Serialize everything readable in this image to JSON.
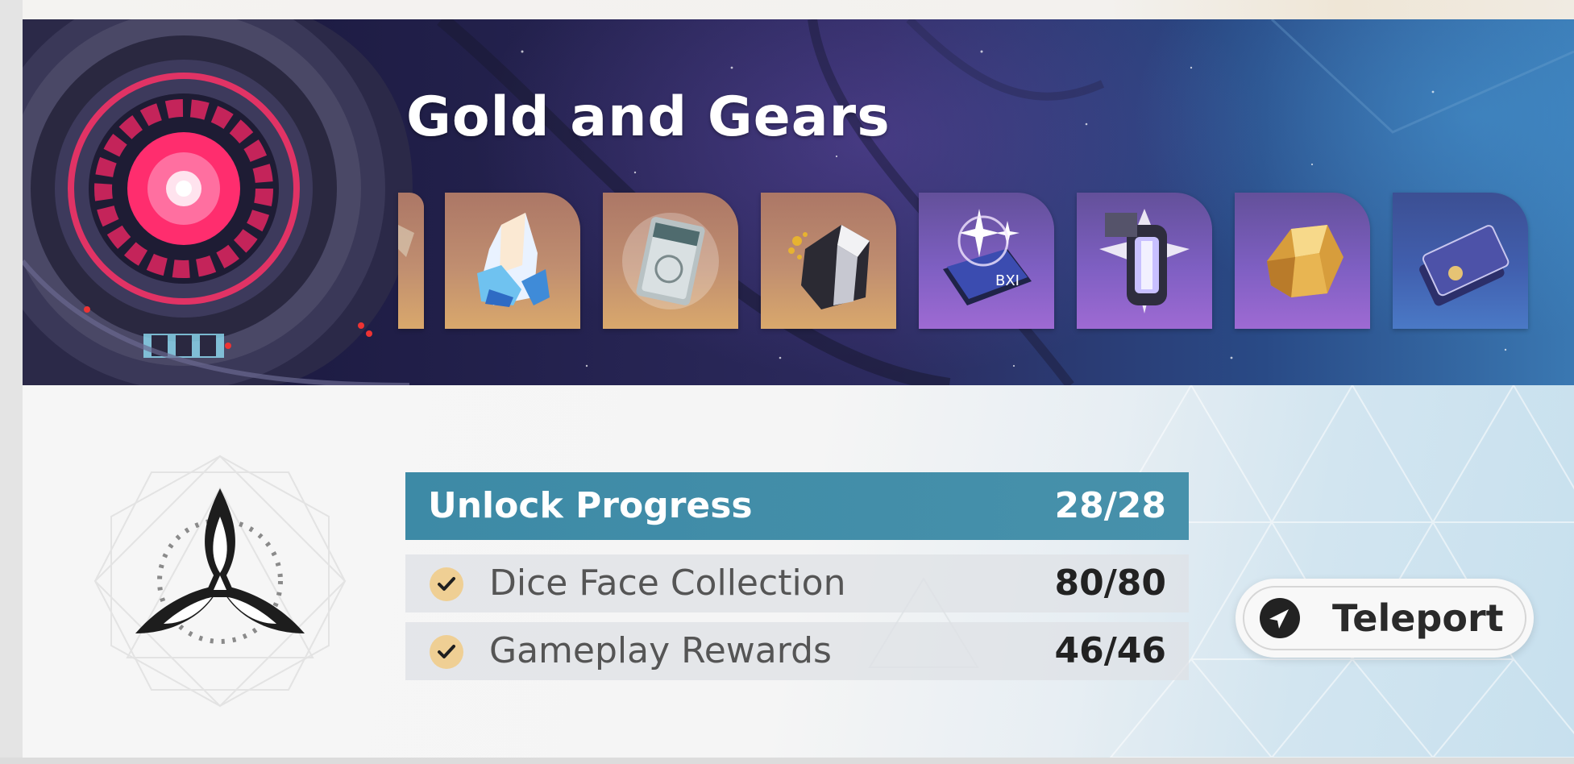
{
  "event": {
    "title": "Gold and Gears"
  },
  "rewards": [
    {
      "name": "partial-item",
      "rarity": "gold"
    },
    {
      "name": "stellar-jade",
      "rarity": "gold"
    },
    {
      "name": "star-rail-pass",
      "rarity": "gold"
    },
    {
      "name": "ore-chunk",
      "rarity": "gold"
    },
    {
      "name": "travel-encounters-book",
      "rarity": "purple"
    },
    {
      "name": "lantern-material",
      "rarity": "purple"
    },
    {
      "name": "gold-ore",
      "rarity": "purple"
    },
    {
      "name": "credential-cards",
      "rarity": "blue"
    }
  ],
  "progress": {
    "header_label": "Unlock Progress",
    "header_value": "28/28",
    "rows": [
      {
        "label": "Dice Face Collection",
        "value": "80/80",
        "completed": true
      },
      {
        "label": "Gameplay Rewards",
        "value": "46/46",
        "completed": true
      }
    ]
  },
  "teleport": {
    "label": "Teleport"
  },
  "colors": {
    "progress_header": "#4791ab",
    "check_badge": "#efcf94",
    "gold_rarity": "#d9a86c",
    "purple_rarity": "#9e6ad3",
    "blue_rarity": "#4a79c6"
  }
}
